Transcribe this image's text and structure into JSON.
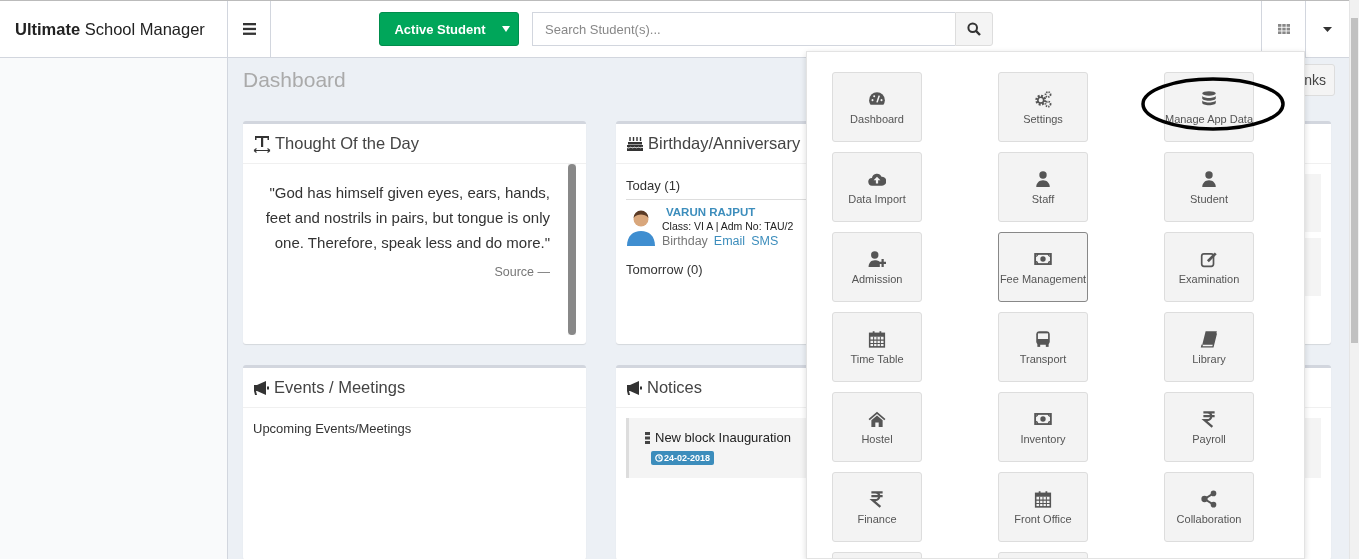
{
  "app": {
    "brand": "**Ultimate** School Manager"
  },
  "header": {
    "filter_button": "Active Student",
    "search": {
      "placeholder": "Search Student(s)..."
    }
  },
  "page": {
    "title": "Dashboard",
    "links_button": "nks"
  },
  "thought": {
    "title": "Thought Of the Day",
    "quote": "\"God has himself given eyes, ears, hands, feet and nostrils in pairs, but tongue is only one. Therefore, speak less and do more.\"",
    "source": "Source —"
  },
  "birthday": {
    "title": "Birthday/Anniversary",
    "today": "Today (1)",
    "people": [
      {
        "name": "VARUN RAJPUT",
        "details": "Class: VI A | Adm No: TAU/2",
        "occasion": "Birthday",
        "actions": [
          "Email",
          "SMS"
        ]
      }
    ],
    "tomorrow": "Tomorrow (0)"
  },
  "events": {
    "title": "Events / Meetings",
    "subtitle": "Upcoming Events/Meetings"
  },
  "notices": {
    "title": "Notices",
    "items": [
      {
        "title": "New block Inauguration",
        "date": "24-02-2018"
      }
    ]
  },
  "app_menu": {
    "expanded": true,
    "tiles": [
      {
        "kind": "app",
        "label": "Dashboard",
        "hovered": false,
        "circled": false
      },
      {
        "kind": "app",
        "label": "Settings",
        "hovered": false,
        "circled": false
      },
      {
        "kind": "app",
        "label": "Manage App Data",
        "hovered": false,
        "circled": true
      },
      {
        "kind": "app",
        "label": "Data Import",
        "hovered": false,
        "circled": false
      },
      {
        "kind": "app",
        "label": "Staff",
        "hovered": false,
        "circled": false
      },
      {
        "kind": "app",
        "label": "Student",
        "hovered": false,
        "circled": false
      },
      {
        "kind": "app",
        "label": "Admission",
        "hovered": false,
        "circled": false
      },
      {
        "kind": "app",
        "label": "Fee Management",
        "hovered": true,
        "circled": false
      },
      {
        "kind": "app",
        "label": "Examination",
        "hovered": false,
        "circled": false
      },
      {
        "kind": "app",
        "label": "Time Table",
        "hovered": false,
        "circled": false
      },
      {
        "kind": "app",
        "label": "Transport",
        "hovered": false,
        "circled": false
      },
      {
        "kind": "app",
        "label": "Library",
        "hovered": false,
        "circled": false
      },
      {
        "kind": "app",
        "label": "Hostel",
        "hovered": false,
        "circled": false
      },
      {
        "kind": "app",
        "label": "Inventory",
        "hovered": false,
        "circled": false
      },
      {
        "kind": "app",
        "label": "Payroll",
        "hovered": false,
        "circled": false
      },
      {
        "kind": "app",
        "label": "Finance",
        "hovered": false,
        "circled": false
      },
      {
        "kind": "app",
        "label": "Front Office",
        "hovered": false,
        "circled": false
      },
      {
        "kind": "app",
        "label": "Collaboration",
        "hovered": false,
        "circled": false
      },
      {
        "kind": "cut"
      },
      {
        "kind": "cut"
      }
    ]
  }
}
